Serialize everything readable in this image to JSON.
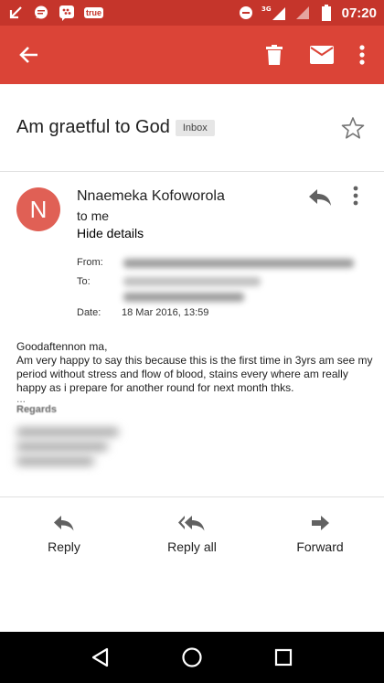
{
  "status_bar": {
    "network_label": "3G",
    "notification_badge": "true",
    "time": "07:20"
  },
  "app_bar": {
    "back_icon": "arrow-back-icon",
    "delete_icon": "trash-icon",
    "mark_unread_icon": "mail-icon",
    "overflow_icon": "more-vert-icon"
  },
  "email": {
    "subject": "Am graetful to God",
    "label": "Inbox",
    "sender_name": "Nnaemeka Kofoworola",
    "sender_initial": "N",
    "recipient_summary": "to me",
    "hide_details": "Hide details",
    "details": {
      "from_label": "From:",
      "to_label": "To:",
      "date_label": "Date:",
      "date_value": "18 Mar 2016, 13:59"
    },
    "body": {
      "greeting": "Goodaftennon ma,",
      "text": "Am very happy to say this because this is the first time in 3yrs am see my period without stress and flow of blood, stains every where am really happy as i prepare for another round for next month thks.",
      "ellipsis": "...",
      "regards": "Regards"
    }
  },
  "actions": {
    "reply": "Reply",
    "reply_all": "Reply all",
    "forward": "Forward"
  },
  "colors": {
    "status_bar": "#c5352b",
    "app_bar": "#db4437",
    "avatar": "#e06055"
  }
}
